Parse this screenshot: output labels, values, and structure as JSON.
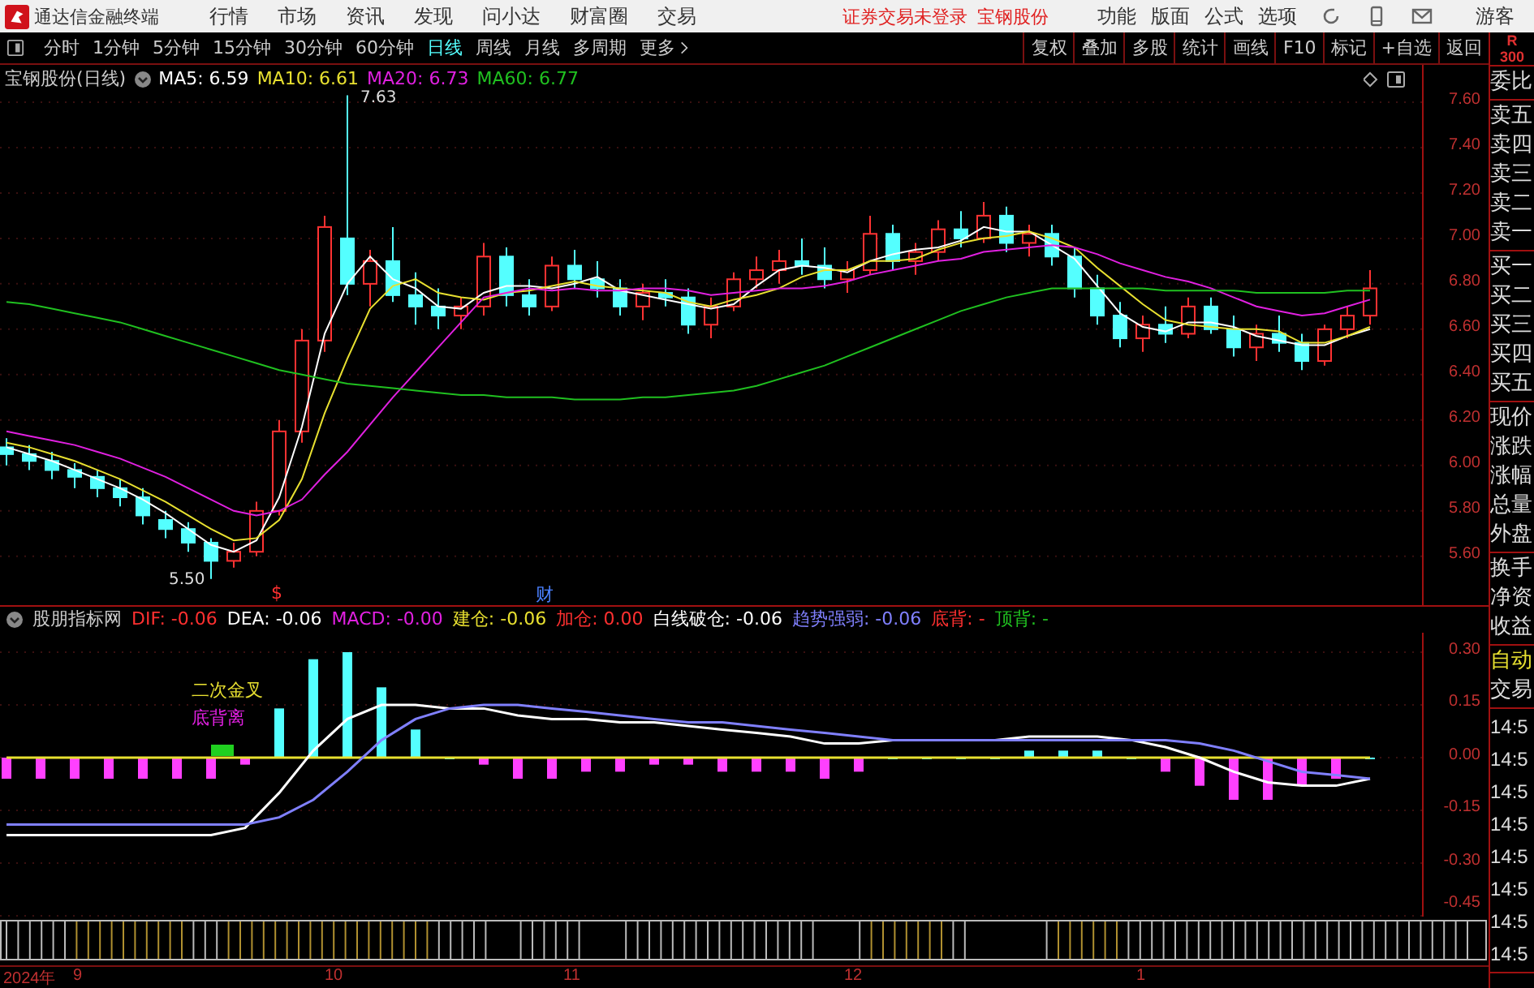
{
  "menu_bar": {
    "app_title": "通达信金融终端",
    "items": [
      "行情",
      "市场",
      "资讯",
      "发现",
      "问小达",
      "财富圈",
      "交易"
    ],
    "status": "证券交易未登录",
    "stock": "宝钢股份",
    "tools": [
      "功能",
      "版面",
      "公式",
      "选项"
    ],
    "user": "游客"
  },
  "period_tabs": [
    {
      "label": "分时",
      "selected": false
    },
    {
      "label": "1分钟",
      "selected": false
    },
    {
      "label": "5分钟",
      "selected": false
    },
    {
      "label": "15分钟",
      "selected": false
    },
    {
      "label": "30分钟",
      "selected": false
    },
    {
      "label": "60分钟",
      "selected": false
    },
    {
      "label": "日线",
      "selected": true
    },
    {
      "label": "周线",
      "selected": false
    },
    {
      "label": "月线",
      "selected": false
    },
    {
      "label": "多周期",
      "selected": false
    },
    {
      "label": "更多",
      "selected": false
    }
  ],
  "chart_tools": [
    "复权",
    "叠加",
    "多股",
    "统计",
    "画线",
    "F10",
    "标记",
    "+自选",
    "返回"
  ],
  "main_chart": {
    "title": "宝钢股份(日线)",
    "ma": [
      {
        "label": "MA5: 6.59",
        "color": "#ffffff"
      },
      {
        "label": "MA10: 6.61",
        "color": "#e8e030"
      },
      {
        "label": "MA20: 6.73",
        "color": "#e020e0"
      },
      {
        "label": "MA60: 6.77",
        "color": "#20c020"
      }
    ],
    "high_label": "7.63",
    "low_label": "5.50",
    "event_marks": [
      {
        "text": "$",
        "color": "#ff3030"
      },
      {
        "text": "财",
        "color": "#4a80ff"
      }
    ],
    "chart_data": {
      "type": "candlestick",
      "ylim": [
        5.385,
        7.764
      ],
      "grid": true,
      "yticks": [
        {
          "value": 7.6,
          "label": "7.60"
        },
        {
          "value": 7.4,
          "label": "7.40"
        },
        {
          "value": 7.2,
          "label": "7.20"
        },
        {
          "value": 7.0,
          "label": "7.00"
        },
        {
          "value": 6.8,
          "label": "6.80"
        },
        {
          "value": 6.6,
          "label": "6.60"
        },
        {
          "value": 6.4,
          "label": "6.40"
        },
        {
          "value": 6.2,
          "label": "6.20"
        },
        {
          "value": 6.0,
          "label": "6.00"
        },
        {
          "value": 5.8,
          "label": "5.80"
        },
        {
          "value": 5.6,
          "label": "5.60"
        }
      ],
      "ohlc": [
        [
          6.08,
          6.12,
          6.0,
          6.05
        ],
        [
          6.05,
          6.09,
          5.98,
          6.02
        ],
        [
          6.02,
          6.06,
          5.94,
          5.98
        ],
        [
          5.98,
          6.01,
          5.9,
          5.95
        ],
        [
          5.95,
          5.98,
          5.86,
          5.9
        ],
        [
          5.9,
          5.94,
          5.82,
          5.86
        ],
        [
          5.86,
          5.9,
          5.74,
          5.78
        ],
        [
          5.76,
          5.8,
          5.68,
          5.72
        ],
        [
          5.72,
          5.75,
          5.62,
          5.66
        ],
        [
          5.66,
          5.68,
          5.5,
          5.58
        ],
        [
          5.58,
          5.66,
          5.55,
          5.62
        ],
        [
          5.62,
          5.84,
          5.6,
          5.8
        ],
        [
          5.8,
          6.2,
          5.78,
          6.15
        ],
        [
          6.15,
          6.6,
          6.1,
          6.55
        ],
        [
          6.55,
          7.1,
          6.5,
          7.05
        ],
        [
          7.0,
          7.63,
          6.75,
          6.8
        ],
        [
          6.8,
          6.95,
          6.7,
          6.9
        ],
        [
          6.9,
          7.05,
          6.72,
          6.75
        ],
        [
          6.75,
          6.85,
          6.62,
          6.7
        ],
        [
          6.7,
          6.78,
          6.6,
          6.66
        ],
        [
          6.66,
          6.74,
          6.6,
          6.7
        ],
        [
          6.7,
          6.98,
          6.66,
          6.92
        ],
        [
          6.92,
          6.96,
          6.7,
          6.75
        ],
        [
          6.75,
          6.82,
          6.66,
          6.7
        ],
        [
          6.7,
          6.92,
          6.68,
          6.88
        ],
        [
          6.88,
          6.95,
          6.78,
          6.82
        ],
        [
          6.82,
          6.9,
          6.74,
          6.78
        ],
        [
          6.78,
          6.82,
          6.66,
          6.7
        ],
        [
          6.7,
          6.8,
          6.64,
          6.76
        ],
        [
          6.76,
          6.82,
          6.7,
          6.74
        ],
        [
          6.74,
          6.78,
          6.58,
          6.62
        ],
        [
          6.62,
          6.74,
          6.56,
          6.7
        ],
        [
          6.7,
          6.85,
          6.68,
          6.82
        ],
        [
          6.82,
          6.92,
          6.78,
          6.86
        ],
        [
          6.86,
          6.95,
          6.8,
          6.9
        ],
        [
          6.9,
          7.0,
          6.84,
          6.88
        ],
        [
          6.88,
          6.96,
          6.78,
          6.82
        ],
        [
          6.82,
          6.9,
          6.76,
          6.86
        ],
        [
          6.86,
          7.1,
          6.84,
          7.02
        ],
        [
          7.02,
          7.06,
          6.86,
          6.9
        ],
        [
          6.9,
          6.98,
          6.84,
          6.94
        ],
        [
          6.94,
          7.08,
          6.9,
          7.04
        ],
        [
          7.04,
          7.12,
          6.96,
          7.0
        ],
        [
          7.0,
          7.16,
          6.98,
          7.1
        ],
        [
          7.1,
          7.14,
          6.94,
          6.98
        ],
        [
          6.98,
          7.06,
          6.92,
          7.02
        ],
        [
          7.02,
          7.06,
          6.88,
          6.92
        ],
        [
          6.92,
          6.96,
          6.74,
          6.78
        ],
        [
          6.78,
          6.84,
          6.62,
          6.66
        ],
        [
          6.66,
          6.72,
          6.52,
          6.56
        ],
        [
          6.56,
          6.66,
          6.5,
          6.62
        ],
        [
          6.62,
          6.7,
          6.54,
          6.58
        ],
        [
          6.58,
          6.74,
          6.56,
          6.7
        ],
        [
          6.7,
          6.74,
          6.58,
          6.6
        ],
        [
          6.6,
          6.66,
          6.48,
          6.52
        ],
        [
          6.52,
          6.62,
          6.46,
          6.58
        ],
        [
          6.58,
          6.66,
          6.5,
          6.54
        ],
        [
          6.54,
          6.58,
          6.42,
          6.46
        ],
        [
          6.46,
          6.62,
          6.44,
          6.6
        ],
        [
          6.6,
          6.7,
          6.56,
          6.66
        ],
        [
          6.66,
          6.86,
          6.62,
          6.78
        ]
      ],
      "series": [
        {
          "type": "line",
          "color": "#ffffff",
          "values": [
            6.08,
            6.05,
            6.02,
            5.98,
            5.94,
            5.9,
            5.85,
            5.79,
            5.72,
            5.65,
            5.62,
            5.67,
            5.86,
            6.17,
            6.58,
            6.8,
            6.92,
            6.82,
            6.78,
            6.7,
            6.69,
            6.76,
            6.79,
            6.79,
            6.78,
            6.8,
            6.83,
            6.77,
            6.75,
            6.73,
            6.71,
            6.69,
            6.71,
            6.79,
            6.86,
            6.88,
            6.87,
            6.85,
            6.9,
            6.93,
            6.95,
            6.96,
            6.99,
            7.05,
            7.03,
            7.03,
            6.97,
            6.91,
            6.79,
            6.67,
            6.61,
            6.59,
            6.63,
            6.63,
            6.61,
            6.57,
            6.55,
            6.53,
            6.53,
            6.57,
            6.6
          ]
        },
        {
          "type": "line",
          "color": "#e8e030",
          "values": [
            6.1,
            6.08,
            6.05,
            6.02,
            5.98,
            5.94,
            5.89,
            5.84,
            5.78,
            5.72,
            5.67,
            5.68,
            5.76,
            5.94,
            6.23,
            6.47,
            6.69,
            6.79,
            6.82,
            6.76,
            6.74,
            6.73,
            6.76,
            6.77,
            6.79,
            6.81,
            6.79,
            6.78,
            6.77,
            6.76,
            6.72,
            6.7,
            6.73,
            6.75,
            6.78,
            6.83,
            6.86,
            6.86,
            6.9,
            6.9,
            6.91,
            6.95,
            6.98,
            7.0,
            7.01,
            7.03,
            7.0,
            6.96,
            6.87,
            6.79,
            6.71,
            6.64,
            6.62,
            6.61,
            6.6,
            6.6,
            6.59,
            6.54,
            6.54,
            6.57,
            6.61
          ]
        },
        {
          "type": "line",
          "color": "#e020e0",
          "values": [
            6.15,
            6.13,
            6.11,
            6.09,
            6.06,
            6.03,
            5.99,
            5.95,
            5.9,
            5.85,
            5.8,
            5.78,
            5.8,
            5.85,
            5.96,
            6.06,
            6.18,
            6.3,
            6.41,
            6.52,
            6.63,
            6.74,
            6.76,
            6.78,
            6.77,
            6.78,
            6.77,
            6.77,
            6.78,
            6.78,
            6.77,
            6.75,
            6.76,
            6.77,
            6.78,
            6.78,
            6.79,
            6.81,
            6.84,
            6.86,
            6.88,
            6.9,
            6.91,
            6.94,
            6.95,
            6.96,
            6.97,
            6.96,
            6.93,
            6.89,
            6.86,
            6.83,
            6.81,
            6.78,
            6.74,
            6.7,
            6.68,
            6.66,
            6.67,
            6.7,
            6.73
          ]
        },
        {
          "type": "line",
          "color": "#20c020",
          "values": [
            6.72,
            6.71,
            6.69,
            6.67,
            6.65,
            6.63,
            6.6,
            6.57,
            6.54,
            6.51,
            6.48,
            6.45,
            6.42,
            6.4,
            6.38,
            6.36,
            6.35,
            6.34,
            6.33,
            6.32,
            6.31,
            6.31,
            6.3,
            6.3,
            6.3,
            6.29,
            6.29,
            6.29,
            6.3,
            6.3,
            6.31,
            6.32,
            6.33,
            6.35,
            6.38,
            6.41,
            6.44,
            6.48,
            6.52,
            6.56,
            6.6,
            6.64,
            6.68,
            6.71,
            6.74,
            6.76,
            6.78,
            6.78,
            6.78,
            6.78,
            6.78,
            6.77,
            6.77,
            6.77,
            6.77,
            6.76,
            6.76,
            6.76,
            6.76,
            6.77,
            6.77
          ]
        }
      ]
    }
  },
  "indicator": {
    "name": "股朋指标网",
    "values": [
      {
        "label": "DIF: -0.06",
        "color": "#ff3030"
      },
      {
        "label": "DEA: -0.06",
        "color": "#ffffff"
      },
      {
        "label": "MACD: -0.00",
        "color": "#e020e0"
      },
      {
        "label": "建仓: -0.06",
        "color": "#e8e030"
      },
      {
        "label": "加仓: 0.00",
        "color": "#ff3030"
      },
      {
        "label": "白线破仓: -0.06",
        "color": "#ffffff"
      },
      {
        "label": "趋势强弱: -0.06",
        "color": "#8080ff"
      },
      {
        "label": "底背: -",
        "color": "#ff3030"
      },
      {
        "label": "顶背: -",
        "color": "#20c020"
      }
    ],
    "annotations": [
      {
        "text": "二次金叉",
        "color": "#e8e030"
      },
      {
        "text": "底背离",
        "color": "#e020e0"
      }
    ],
    "chart_data": {
      "type": "line",
      "ylim": [
        -0.4523,
        0.3554
      ],
      "grid": true,
      "yticks": [
        {
          "value": 0.3,
          "label": "0.30"
        },
        {
          "value": 0.15,
          "label": "0.15"
        },
        {
          "value": 0,
          "label": "0.00"
        },
        {
          "value": -0.15,
          "label": "-0.15"
        },
        {
          "value": -0.3,
          "label": "-0.30"
        },
        {
          "value": -0.45,
          "label": "-0.45"
        }
      ],
      "series": [
        {
          "type": "bar",
          "color": "#54ffff",
          "values": [
            null,
            null,
            null,
            null,
            null,
            null,
            null,
            null,
            0.14,
            0.28,
            0.3,
            0.2,
            0.08,
            0,
            null,
            null,
            null,
            null,
            null,
            null,
            null,
            null,
            null,
            null,
            null,
            null,
            0,
            0,
            0,
            0,
            0.02,
            0.02,
            0.02,
            0,
            null,
            null,
            null,
            null,
            null,
            null,
            0
          ]
        },
        {
          "type": "bar",
          "color": "#ff40ff",
          "values": [
            -0.06,
            -0.06,
            -0.06,
            -0.06,
            -0.06,
            -0.06,
            -0.06,
            -0.02,
            null,
            null,
            null,
            null,
            null,
            null,
            -0.02,
            -0.06,
            -0.06,
            -0.04,
            -0.04,
            -0.02,
            -0.02,
            -0.04,
            -0.04,
            -0.04,
            -0.06,
            -0.04,
            null,
            null,
            null,
            null,
            null,
            null,
            null,
            null,
            -0.04,
            -0.08,
            -0.12,
            -0.12,
            -0.08,
            -0.06,
            null
          ]
        },
        {
          "type": "line",
          "color": "#e8e030",
          "values": [
            0,
            0,
            0,
            0,
            0,
            0,
            0,
            0,
            0,
            0,
            0,
            0,
            0,
            0,
            0,
            0,
            0,
            0,
            0,
            0,
            0,
            0,
            0,
            0,
            0,
            0,
            0,
            0,
            0,
            0,
            0,
            0,
            0,
            0,
            0,
            0,
            0,
            0,
            0,
            0,
            0
          ]
        },
        {
          "type": "line",
          "color": "#ffffff",
          "values": [
            -0.22,
            -0.22,
            -0.22,
            -0.22,
            -0.22,
            -0.22,
            -0.22,
            -0.2,
            -0.1,
            0.02,
            0.11,
            0.15,
            0.15,
            0.14,
            0.14,
            0.12,
            0.11,
            0.11,
            0.1,
            0.1,
            0.09,
            0.08,
            0.07,
            0.06,
            0.04,
            0.04,
            0.05,
            0.05,
            0.05,
            0.05,
            0.06,
            0.06,
            0.06,
            0.05,
            0.03,
            0.0,
            -0.04,
            -0.07,
            -0.08,
            -0.08,
            -0.06
          ]
        },
        {
          "type": "line",
          "color": "#8080ff",
          "values": [
            -0.19,
            -0.19,
            -0.19,
            -0.19,
            -0.19,
            -0.19,
            -0.19,
            -0.19,
            -0.17,
            -0.12,
            -0.04,
            0.05,
            0.11,
            0.14,
            0.15,
            0.15,
            0.14,
            0.13,
            0.12,
            0.11,
            0.1,
            0.1,
            0.09,
            0.08,
            0.07,
            0.06,
            0.05,
            0.05,
            0.05,
            0.05,
            0.05,
            0.05,
            0.05,
            0.05,
            0.05,
            0.04,
            0.02,
            -0.01,
            -0.04,
            -0.05,
            -0.06
          ]
        }
      ]
    }
  },
  "date_axis": [
    "2024年",
    "9",
    "10",
    "11",
    "12",
    "1"
  ],
  "quote_panel": {
    "header": [
      "R",
      "300"
    ],
    "groups": [
      [
        {
          "label": "委比",
          "kind": "normal"
        }
      ],
      [
        {
          "label": "卖五",
          "kind": "normal"
        },
        {
          "label": "卖四",
          "kind": "normal"
        },
        {
          "label": "卖三",
          "kind": "normal"
        },
        {
          "label": "卖二",
          "kind": "normal"
        },
        {
          "label": "卖一",
          "kind": "normal"
        }
      ],
      [
        {
          "label": "买一",
          "kind": "normal"
        },
        {
          "label": "买二",
          "kind": "normal"
        },
        {
          "label": "买三",
          "kind": "normal"
        },
        {
          "label": "买四",
          "kind": "normal"
        },
        {
          "label": "买五",
          "kind": "normal"
        }
      ],
      [
        {
          "label": "现价",
          "kind": "normal"
        },
        {
          "label": "涨跌",
          "kind": "normal"
        },
        {
          "label": "涨幅",
          "kind": "normal"
        },
        {
          "label": "总量",
          "kind": "normal"
        },
        {
          "label": "外盘",
          "kind": "normal"
        }
      ],
      [
        {
          "label": "换手",
          "kind": "normal"
        },
        {
          "label": "净资",
          "kind": "normal"
        },
        {
          "label": "收益",
          "kind": "normal"
        }
      ],
      [
        {
          "label": "自动",
          "kind": "highlight"
        },
        {
          "label": "交易",
          "kind": "normal"
        }
      ],
      [
        {
          "label": "14:5",
          "kind": "time"
        },
        {
          "label": "14:5",
          "kind": "time"
        },
        {
          "label": "14:5",
          "kind": "time"
        },
        {
          "label": "14:5",
          "kind": "time"
        },
        {
          "label": "14:5",
          "kind": "time"
        },
        {
          "label": "14:5",
          "kind": "time"
        },
        {
          "label": "14:5",
          "kind": "time"
        },
        {
          "label": "14:5",
          "kind": "time"
        }
      ]
    ]
  }
}
